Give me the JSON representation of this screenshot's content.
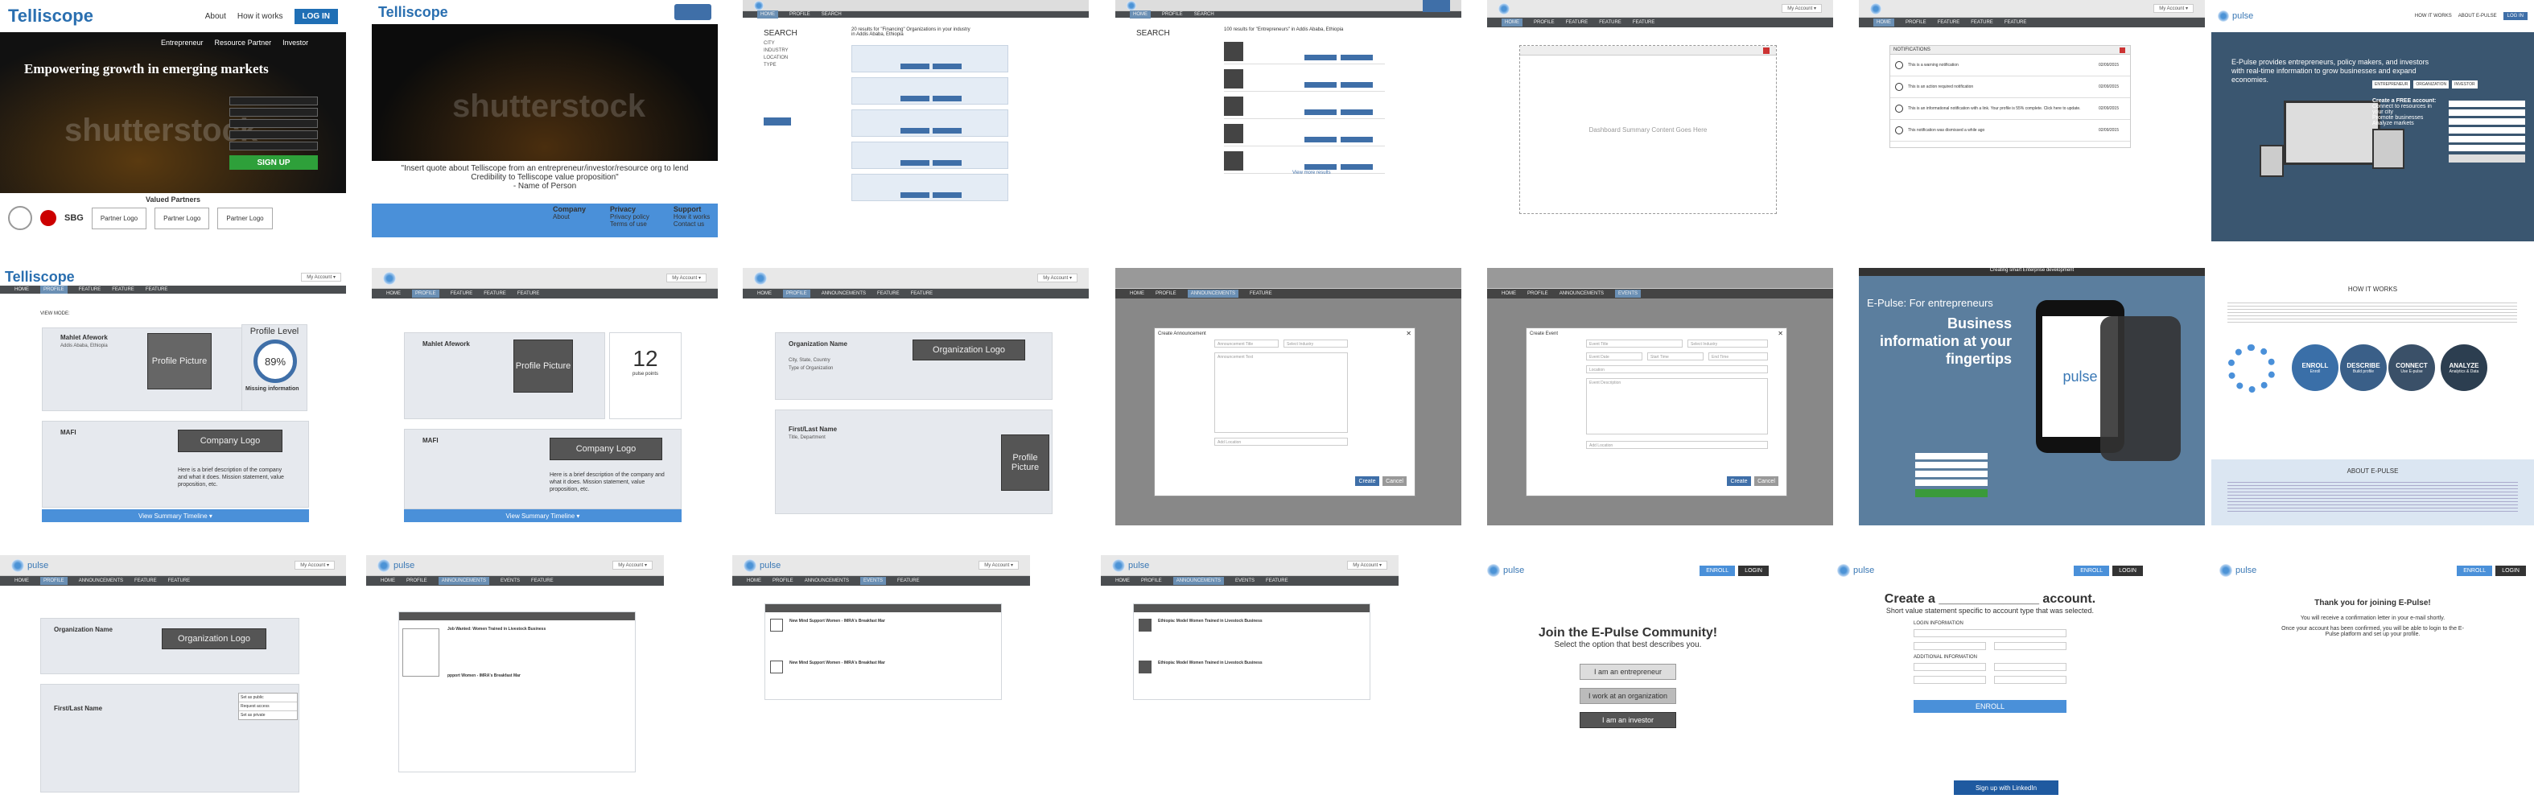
{
  "f1": {
    "logo": "Telliscope",
    "nav": [
      "About",
      "How it works",
      "LOG IN"
    ],
    "subnav": [
      "Entrepreneur",
      "Resource Partner",
      "Investor"
    ],
    "hero": "Empowering  growth in emerging markets",
    "watermark": "shutterstock",
    "signup": "SIGN UP",
    "partners_title": "Valued Partners",
    "partner_sbg": "SBG",
    "partner_logo": "Partner Logo"
  },
  "f2": {
    "logo": "Telliscope",
    "watermark": "shutterstock",
    "quote": "\"Insert quote about Telliscope from an entrepreneur/investor/resource org to lend Credibility to Telliscope value proposition\"",
    "quote_name": "- Name of Person",
    "footer": [
      {
        "title": "Company",
        "items": [
          "About"
        ]
      },
      {
        "title": "Privacy",
        "items": [
          "Privacy policy",
          "Terms of use"
        ]
      },
      {
        "title": "Support",
        "items": [
          "How it works",
          "Contact us"
        ]
      }
    ]
  },
  "f3": {
    "search": "SEARCH",
    "results": "20 results for \"Financing\" Organizations in your industry in Addis Ababa, Ethiopia"
  },
  "f4": {
    "search": "SEARCH",
    "results": "100 results for \"Entrepreneurs\" in Addis Ababa, Ethiopia",
    "more": "View more results"
  },
  "f5": {
    "menu": [
      "HOME",
      "PROFILE",
      "FEATURE",
      "FEATURE",
      "FEATURE"
    ],
    "account": "My Account ▾",
    "placeholder": "Dashboard Summary Content Goes Here"
  },
  "f6": {
    "title": "NOTIFICATIONS",
    "items": [
      {
        "text": "This is a warning notification",
        "date": "02/09/2015"
      },
      {
        "text": "This is an action required notification",
        "date": "02/09/2015"
      },
      {
        "text": "This is an informational notification with a link. Your profile is 55% complete. Click here to update.",
        "date": "02/09/2015"
      },
      {
        "text": "This notification was dismissed a while ago",
        "date": "02/09/2015"
      }
    ]
  },
  "f7": {
    "nav": [
      "HOW IT WORKS",
      "ABOUT E-PULSE",
      "LOG IN"
    ],
    "hero": "E-Pulse provides entrepreneurs, policy makers, and investors with real-time information to grow businesses and expand economies.",
    "free": "Create a FREE account:",
    "bullets": [
      "Connect to resources in your city",
      "Promote businesses",
      "Analyze markets"
    ],
    "roles": [
      "ENTREPRENEUR",
      "ORGANIZATION",
      "INVESTOR"
    ]
  },
  "profile_a": {
    "logo": "Telliscope",
    "name": "Mahlet Afework",
    "city": "Addis Ababa, Ethiopia",
    "picture": "Profile Picture",
    "level": "Profile Level",
    "pct": "89%",
    "missing": "Missing information",
    "company": "MAFI",
    "company_logo": "Company Logo",
    "desc": "Here is a brief description of the company and what it does. Mission statement, value proposition, etc.",
    "timeline": "View Summary Timeline ▾",
    "mode": "VIEW MODE:"
  },
  "profile_b": {
    "name": "Mahlet Afework",
    "points": "12",
    "points_label": "pulse points",
    "picture": "Profile Picture",
    "company": "MAFI",
    "company_logo": "Company Logo",
    "desc": "Here is a brief description of the company and what it does. Mission statement, value proposition, etc.",
    "timeline": "View Summary Timeline ▾"
  },
  "org_a": {
    "name": "Organization Name",
    "loc": "City, State, Country",
    "type": "Type of Organization",
    "logo": "Organization Logo",
    "person": "First/Last Name",
    "dept": "Title, Department",
    "picture": "Profile Picture"
  },
  "modal_a": {
    "title": "Create Announcement",
    "fields": [
      "Announcement Title",
      "Select Industry",
      "Announcement Text",
      "Add Location"
    ],
    "buttons": [
      "Create",
      "Cancel"
    ]
  },
  "modal_b": {
    "title": "Create Event",
    "fields": [
      "Event Title",
      "Select Industry",
      "Event Date",
      "Start Time",
      "End Time",
      "Location",
      "Event Description",
      "Add Location"
    ],
    "buttons": [
      "Create",
      "Cancel"
    ]
  },
  "ad": {
    "heading": "E-Pulse: For entrepreneurs",
    "big": "Business information at your fingertips",
    "phone_logo": "pulse",
    "tagline": "Creating smart Enterprise development"
  },
  "how": {
    "title": "HOW IT WORKS",
    "steps": [
      {
        "label": "ENROLL",
        "sub": "Enroll"
      },
      {
        "label": "DESCRIBE",
        "sub": "Build profile"
      },
      {
        "label": "CONNECT",
        "sub": "Use E-pulse"
      },
      {
        "label": "ANALYZE",
        "sub": "Analytics & Data"
      }
    ],
    "about": "ABOUT E-PULSE"
  },
  "row3": {
    "menu": [
      "HOME",
      "PROFILE",
      "ANNOUNCEMENTS",
      "FEATURE",
      "FEATURE"
    ],
    "org_name": "Organization Name",
    "org_logo": "Organization Logo",
    "person": "First/Last Name",
    "privacy": [
      "Set as public",
      "Request access",
      "Set as private"
    ],
    "ann_title": "Job Wanted: Women Trained in Livestock Business",
    "ann_title2": "ppport Women - IMRA's Breakfast Mar",
    "event1": "New Mind Support Women - IMRA's Breakfast Mar",
    "event2": "New Mind Support Women - IMRA's Breakfast Mar",
    "ann1": "Ethiopia: Model Women Trained in Livestock Business",
    "ann2": "Ethiopia: Model Women Trained in Livestock Business"
  },
  "join": {
    "title": "Join the E-Pulse Community!",
    "sub": "Select the option that best describes you.",
    "options": [
      "I am an entrepreneur",
      "I work at an organization",
      "I am an investor"
    ],
    "enroll": "ENROLL",
    "login": "LOGIN"
  },
  "create": {
    "title": "Create a ______________ account.",
    "sub": "Short value statement specific to account type that was selected.",
    "login_info": "LOGIN INFORMATION",
    "additional": "ADDITIONAL INFORMATION",
    "enroll": "ENROLL",
    "linkedin": "Sign up with LinkedIn"
  },
  "thanks": {
    "title": "Thank you for joining E-Pulse!",
    "l1": "You will receive a confirmation letter in your e-mail shortly.",
    "l2": "Once your account has been confirmed, you will be able to login to the E-Pulse platform and set up your profile."
  }
}
